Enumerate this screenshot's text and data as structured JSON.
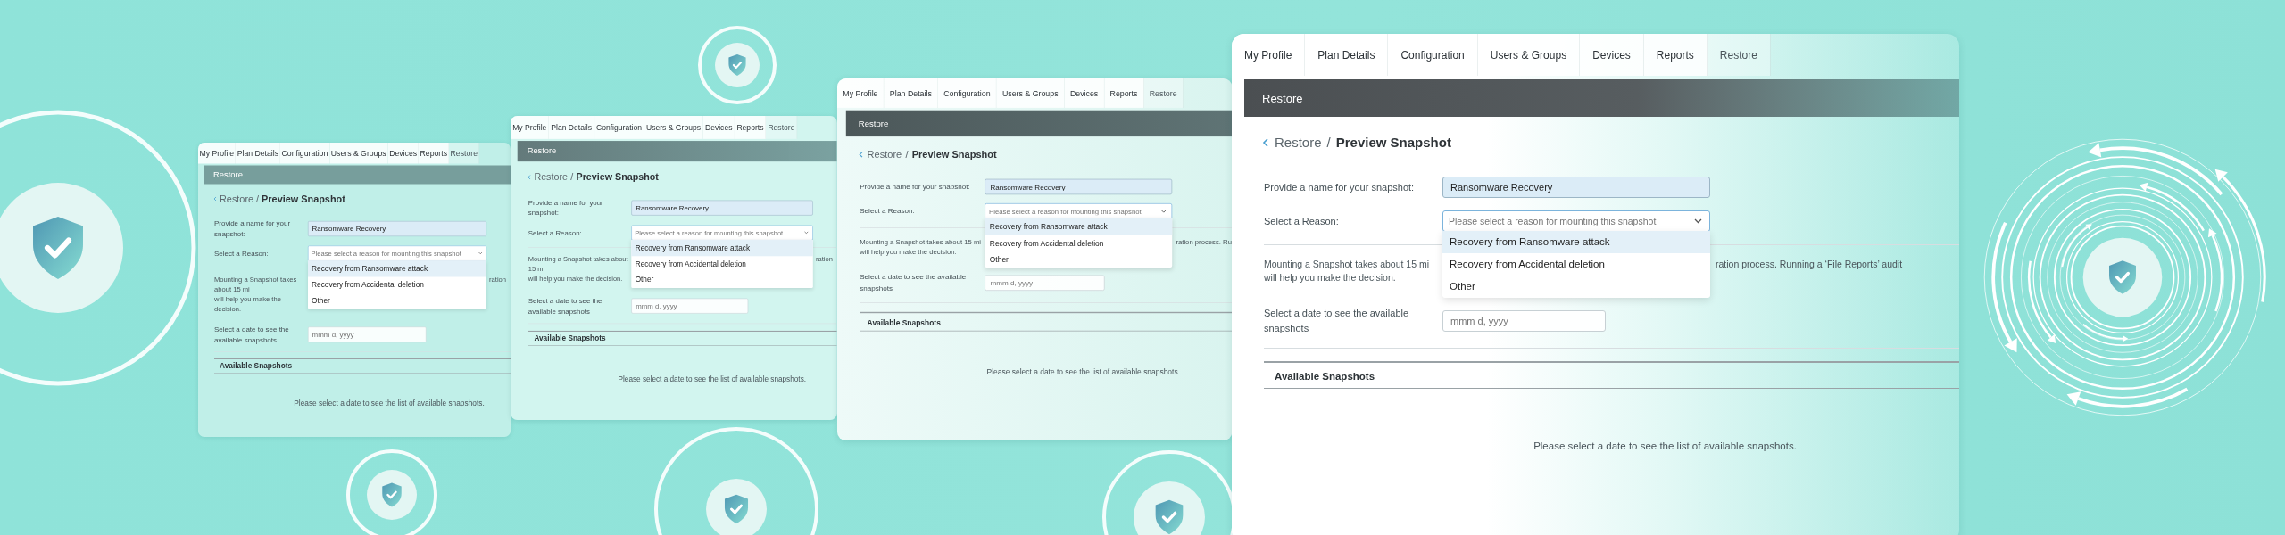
{
  "windows": [
    {
      "tabs": [
        {
          "label": "My Profile",
          "selected": false
        },
        {
          "label": "Plan Details",
          "selected": false
        },
        {
          "label": "Configuration",
          "selected": false
        },
        {
          "label": "Users & Groups",
          "selected": false
        },
        {
          "label": "Devices",
          "selected": false
        },
        {
          "label": "Reports",
          "selected": false
        },
        {
          "label": "Restore",
          "selected": true
        }
      ],
      "header_title": "Restore",
      "breadcrumb": {
        "parent": "Restore",
        "separator": "/",
        "current": "Preview Snapshot"
      },
      "name_field": {
        "label": "Provide a name for your snapshot:",
        "value": "Ransomware Recovery"
      },
      "reason_field": {
        "label": "Select a Reason:",
        "placeholder": "Please select a reason for mounting this snapshot",
        "expanded": true,
        "options": [
          {
            "label": "Recovery from Ransomware attack",
            "selected": true
          },
          {
            "label": "Recovery from Accidental deletion",
            "selected": false
          },
          {
            "label": "Other",
            "selected": false
          }
        ]
      },
      "description_left": [
        "Mounting a Snapshot takes about 15 mi",
        "will help you make the decision."
      ],
      "description_right": "ration",
      "date_field": {
        "label": "Select a date to see the available snapshots",
        "placeholder": "mmm d, yyyy"
      },
      "section_title": "Available Snapshots",
      "empty_message": "Please select a date to see the list of available snapshots."
    },
    {
      "tabs": [
        {
          "label": "My Profile",
          "selected": false
        },
        {
          "label": "Plan Details",
          "selected": false
        },
        {
          "label": "Configuration",
          "selected": false
        },
        {
          "label": "Users & Groups",
          "selected": false
        },
        {
          "label": "Devices",
          "selected": false
        },
        {
          "label": "Reports",
          "selected": false
        },
        {
          "label": "Restore",
          "selected": true
        }
      ],
      "header_title": "Restore",
      "breadcrumb": {
        "parent": "Restore",
        "separator": "/",
        "current": "Preview Snapshot"
      },
      "name_field": {
        "label": "Provide a name for your snapshot:",
        "value": "Ransomware Recovery"
      },
      "reason_field": {
        "label": "Select a Reason:",
        "placeholder": "Please select a reason for mounting this snapshot",
        "expanded": true,
        "options": [
          {
            "label": "Recovery from Ransomware attack",
            "selected": true
          },
          {
            "label": "Recovery from Accidental deletion",
            "selected": false
          },
          {
            "label": "Other",
            "selected": false
          }
        ]
      },
      "description_left": [
        "Mounting a Snapshot takes about 15 mi",
        "will help you make the decision."
      ],
      "description_right": "ration",
      "date_field": {
        "label": "Select a date to see the available snapshots",
        "placeholder": "mmm d, yyyy"
      },
      "section_title": "Available Snapshots",
      "empty_message": "Please select a date to see the list of available snapshots."
    },
    {
      "tabs": [
        {
          "label": "My Profile",
          "selected": false
        },
        {
          "label": "Plan Details",
          "selected": false
        },
        {
          "label": "Configuration",
          "selected": false
        },
        {
          "label": "Users & Groups",
          "selected": false
        },
        {
          "label": "Devices",
          "selected": false
        },
        {
          "label": "Reports",
          "selected": false
        },
        {
          "label": "Restore",
          "selected": true
        }
      ],
      "header_title": "Restore",
      "breadcrumb": {
        "parent": "Restore",
        "separator": "/",
        "current": "Preview Snapshot"
      },
      "name_field": {
        "label": "Provide a name for your snapshot:",
        "value": "Ransomware Recovery"
      },
      "reason_field": {
        "label": "Select a Reason:",
        "placeholder": "Please select a reason for mounting this snapshot",
        "expanded": true,
        "options": [
          {
            "label": "Recovery from Ransomware attack",
            "selected": true
          },
          {
            "label": "Recovery from Accidental deletion",
            "selected": false
          },
          {
            "label": "Other",
            "selected": false
          }
        ]
      },
      "description_left": [
        "Mounting a Snapshot takes about 15 mi",
        "will help you make the decision."
      ],
      "description_right": "ration process. Ru",
      "date_field": {
        "label": "Select a date to see the available snapshots",
        "placeholder": "mmm d, yyyy"
      },
      "section_title": "Available Snapshots",
      "empty_message": "Please select a date to see the list of available snapshots."
    },
    {
      "tabs": [
        {
          "label": "My Profile",
          "selected": false
        },
        {
          "label": "Plan Details",
          "selected": false
        },
        {
          "label": "Configuration",
          "selected": false
        },
        {
          "label": "Users & Groups",
          "selected": false
        },
        {
          "label": "Devices",
          "selected": false
        },
        {
          "label": "Reports",
          "selected": false
        },
        {
          "label": "Restore",
          "selected": true
        }
      ],
      "header_title": "Restore",
      "breadcrumb": {
        "parent": "Restore",
        "separator": "/",
        "current": "Preview Snapshot"
      },
      "name_field": {
        "label": "Provide a name for your snapshot:",
        "value": "Ransomware Recovery"
      },
      "reason_field": {
        "label": "Select a Reason:",
        "placeholder": "Please select a reason for mounting this snapshot",
        "expanded": true,
        "options": [
          {
            "label": "Recovery from Ransomware attack",
            "selected": true
          },
          {
            "label": "Recovery from Accidental deletion",
            "selected": false
          },
          {
            "label": "Other",
            "selected": false
          }
        ]
      },
      "description_left": [
        "Mounting a Snapshot takes about 15 mi",
        "will help you make the decision."
      ],
      "description_right": "ration process. Running a ‘File Reports’ audit",
      "date_field": {
        "label": "Select a date to see the available snapshots",
        "placeholder": "mmm d, yyyy"
      },
      "section_title": "Available Snapshots",
      "empty_message": "Please select a date to see the list of available snapshots."
    }
  ]
}
